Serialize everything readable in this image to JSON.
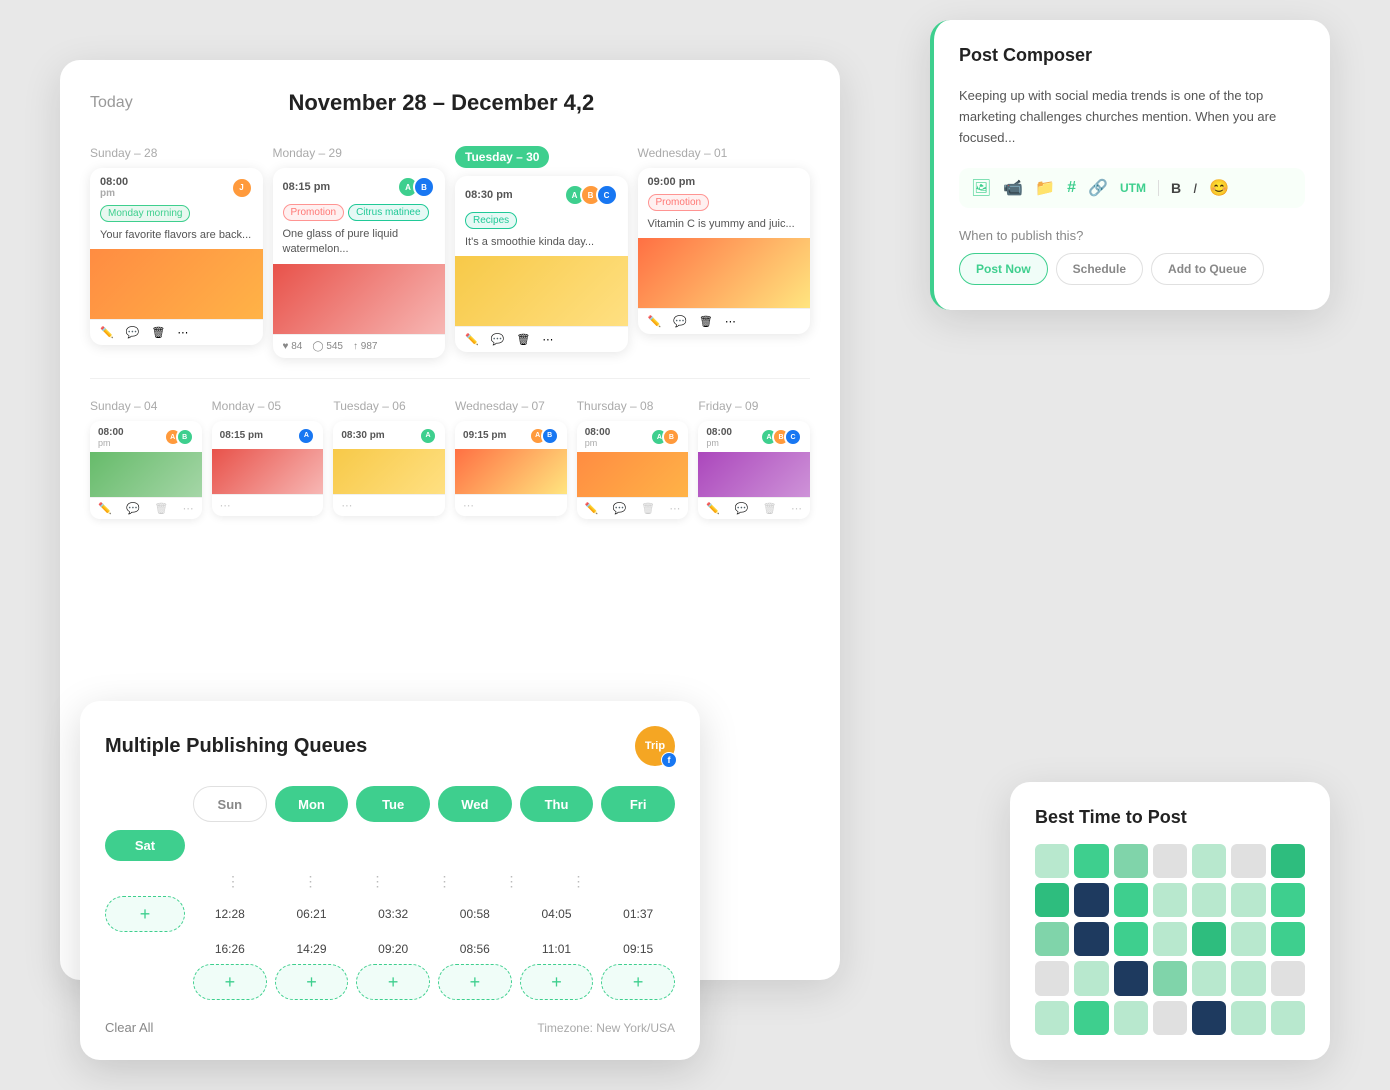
{
  "main": {
    "today_label": "Today",
    "date_range": "November 28 – December 4,2",
    "week1": {
      "days": [
        {
          "label": "Sunday – 28",
          "active": false,
          "posts": [
            {
              "time": "08:00",
              "sub_time": "pm",
              "tags": [
                {
                  "text": "Monday morning",
                  "style": "green"
                }
              ],
              "text": "Your favorite flavors are back...",
              "img_style": "img-orange",
              "avatars": [
                "#ff9a3c"
              ],
              "stats": []
            }
          ]
        },
        {
          "label": "Monday – 29",
          "active": false,
          "posts": [
            {
              "time": "08:15 pm",
              "tags": [
                {
                  "text": "Promotion",
                  "style": "pink"
                },
                {
                  "text": "Citrus matinee",
                  "style": "teal"
                }
              ],
              "text": "One glass of pure liquid watermelon...",
              "img_style": "img-watermelon",
              "avatars": [
                "#3ecf8e",
                "#1877f2"
              ],
              "stats": [
                {
                  "icon": "♥",
                  "count": "84"
                },
                {
                  "icon": "◯",
                  "count": "545"
                },
                {
                  "icon": "↑",
                  "count": "987"
                }
              ]
            }
          ]
        },
        {
          "label": "Tuesday – 30",
          "active": true,
          "posts": [
            {
              "time": "08:30 pm",
              "tags": [
                {
                  "text": "Recipes",
                  "style": "teal"
                }
              ],
              "text": "It's a smoothie kinda day...",
              "img_style": "img-mango",
              "avatars": [
                "#3ecf8e",
                "#ff9a3c",
                "#1877f2"
              ],
              "stats": []
            }
          ]
        },
        {
          "label": "Wednesday – 01",
          "active": false,
          "posts": [
            {
              "time": "09:00 pm",
              "tags": [
                {
                  "text": "Promotion",
                  "style": "red"
                }
              ],
              "text": "Vitamin C is yummy and juic...",
              "img_style": "img-citrus",
              "avatars": [],
              "stats": []
            }
          ]
        }
      ]
    },
    "week2": {
      "days": [
        {
          "label": "Sunday – 04",
          "time": "08:00",
          "sub_time": "pm",
          "img_style": "img-fruit2"
        },
        {
          "label": "Monday – 05",
          "time": "08:15 pm",
          "img_style": "img-watermelon"
        },
        {
          "label": "Tuesday – 06",
          "time": "08:30 pm",
          "img_style": "img-mango"
        },
        {
          "label": "Wednesday – 07",
          "time": "09:15 pm",
          "img_style": "img-citrus"
        },
        {
          "label": "Thursday – 08",
          "time": "08:00",
          "sub_time": "pm",
          "img_style": "img-orange"
        },
        {
          "label": "Friday – 09",
          "time": "08:00",
          "sub_time": "pm",
          "img_style": "img-fruit3"
        }
      ]
    }
  },
  "queue": {
    "title": "Multiple Publishing Queues",
    "days": [
      {
        "label": "Sun",
        "active": false
      },
      {
        "label": "Mon",
        "active": true
      },
      {
        "label": "Tue",
        "active": true
      },
      {
        "label": "Wed",
        "active": true
      },
      {
        "label": "Thu",
        "active": true
      },
      {
        "label": "Fri",
        "active": true
      },
      {
        "label": "Sat",
        "active": true
      }
    ],
    "times_row1": [
      "",
      "12:28",
      "06:21",
      "03:32",
      "00:58",
      "04:05",
      "01:37"
    ],
    "times_row2": [
      "",
      "16:26",
      "14:29",
      "09:20",
      "08:56",
      "11:01",
      "09:15"
    ],
    "footer_clear": "Clear All",
    "footer_tz": "Timezone: New York/USA"
  },
  "composer": {
    "title": "Post Composer",
    "text": "Keeping up with social media trends is one of the top marketing challenges churches mention. When you are focused...",
    "toolbar_icons": [
      "image",
      "video",
      "folder",
      "hashtag",
      "link",
      "utm",
      "bold",
      "italic",
      "emoji"
    ],
    "publish_label": "When to publish this?",
    "publish_options": [
      {
        "label": "Post Now",
        "active": true
      },
      {
        "label": "Schedule",
        "active": false
      },
      {
        "label": "Add to Queue",
        "active": false
      }
    ]
  },
  "best_time": {
    "title": "Best Time to Post",
    "grid": [
      "light",
      "medium",
      "light-medium",
      "none",
      "light",
      "none",
      "dark-green",
      "dark-green",
      "dark-navy",
      "medium",
      "light",
      "light",
      "light",
      "medium",
      "light-medium",
      "dark-navy",
      "medium",
      "light",
      "dark-green",
      "light",
      "medium",
      "none",
      "light",
      "dark-navy",
      "light-medium",
      "light",
      "light",
      "none",
      "light",
      "medium",
      "light",
      "none",
      "dark-navy",
      "light",
      "light"
    ]
  }
}
